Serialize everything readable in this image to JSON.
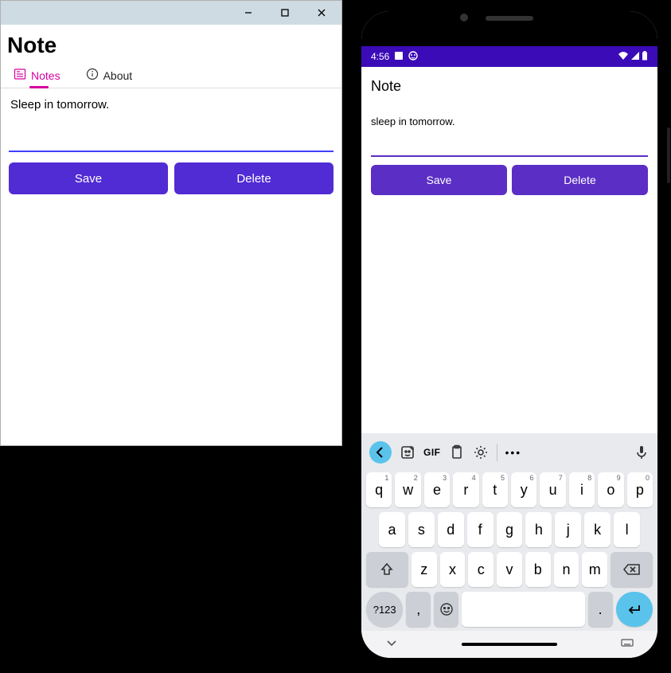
{
  "desktop": {
    "title": "Note",
    "tabs": {
      "notes": "Notes",
      "about": "About"
    },
    "note_text": "Sleep in tomorrow.",
    "save_label": "Save",
    "delete_label": "Delete"
  },
  "phone": {
    "status_time": "4:56",
    "title": "Note",
    "note_text": "sleep in tomorrow.",
    "save_label": "Save",
    "delete_label": "Delete",
    "keyboard": {
      "gif_label": "GIF",
      "more_label": "•••",
      "row1": [
        {
          "ch": "q",
          "num": "1"
        },
        {
          "ch": "w",
          "num": "2"
        },
        {
          "ch": "e",
          "num": "3"
        },
        {
          "ch": "r",
          "num": "4"
        },
        {
          "ch": "t",
          "num": "5"
        },
        {
          "ch": "y",
          "num": "6"
        },
        {
          "ch": "u",
          "num": "7"
        },
        {
          "ch": "i",
          "num": "8"
        },
        {
          "ch": "o",
          "num": "9"
        },
        {
          "ch": "p",
          "num": "0"
        }
      ],
      "row2": [
        "a",
        "s",
        "d",
        "f",
        "g",
        "h",
        "j",
        "k",
        "l"
      ],
      "row3": [
        "z",
        "x",
        "c",
        "v",
        "b",
        "n",
        "m"
      ],
      "sym_label": "?123",
      "comma": ",",
      "period": "."
    }
  }
}
